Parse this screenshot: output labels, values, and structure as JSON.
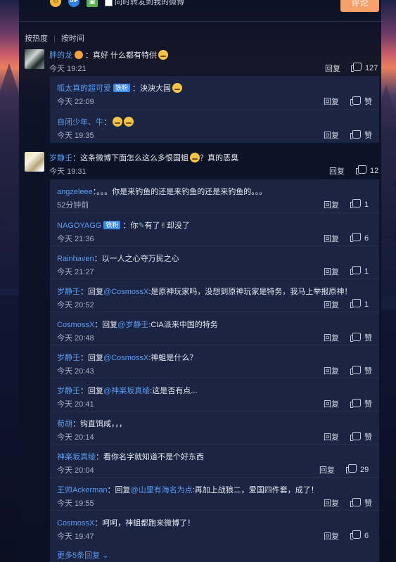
{
  "composer": {
    "forward_label": "同时转发到我的微博",
    "submit_label": "评论"
  },
  "sort": {
    "hot": "按热度",
    "time": "按时间"
  },
  "comments": [
    {
      "user": "胖的龙",
      "text": "：真好 什么都有特供",
      "time": "今天 19:21",
      "reply": "回复",
      "likes": "127",
      "replies": [
        {
          "user": "呱太真的超可爱",
          "tag": "铁粉",
          "text": "：泱泱大国",
          "time": "今天 22:09",
          "reply": "回复",
          "likes": "赞"
        },
        {
          "user": "自闭少年、牛",
          "text": "：",
          "time": "今天 19:35",
          "reply": "回复",
          "likes": "赞"
        }
      ]
    },
    {
      "user": "岁静壬",
      "text": "：这条微博下面怎么这么多恨国蛆",
      "text2": "？真的恶臭",
      "time": "今天 19:31",
      "reply": "回复",
      "likes": "12",
      "replies": [
        {
          "user": "angzeleee",
          "text": "：。。。你是来钓鱼的还是来钓鱼的还是来钓鱼的。。。",
          "time": "52分钟前",
          "reply": "回复",
          "likes": "1"
        },
        {
          "user": "NAGOYAGG",
          "tag": "铁粉",
          "text": "：你",
          "text2": "有了",
          "text3": "却没了",
          "time": "今天 21:36",
          "reply": "回复",
          "likes": "6"
        },
        {
          "user": "Rainhaven",
          "text": "：以一人之心夺万民之心",
          "time": "今天 21:27",
          "reply": "回复",
          "likes": "1"
        },
        {
          "user": "岁静壬",
          "pre": "：回复",
          "mention": "@CosmossX",
          "text": ":是原神玩家吗，没想到原神玩家是特务，我马上举报原神！",
          "time": "今天 20:52",
          "reply": "回复",
          "likes": "1"
        },
        {
          "user": "CosmossX",
          "pre": "：回复",
          "mention": "@岁静壬",
          "text": ":CIA派来中国的特务",
          "time": "今天 20:48",
          "reply": "回复",
          "likes": "赞"
        },
        {
          "user": "岁静壬",
          "pre": "：回复",
          "mention": "@CosmossX",
          "text": ":神蛆是什么？",
          "time": "今天 20:43",
          "reply": "回复",
          "likes": "赞"
        },
        {
          "user": "岁静壬",
          "pre": "：回复",
          "mention": "@神楽坂真绫",
          "text": ":这是否有点...",
          "time": "今天 20:41",
          "reply": "回复",
          "likes": "赞"
        },
        {
          "user": "荀胡",
          "text": "：钩直饵咸，，，",
          "time": "今天 20:14",
          "reply": "回复",
          "likes": "赞"
        },
        {
          "user": "神楽坂真绫",
          "text": "：看你名字就知道不是个好东西",
          "time": "今天 20:04",
          "reply": "回复",
          "likes": "29"
        },
        {
          "user": "王帅Ackerman",
          "pre": "：回复",
          "mention": "@山里有海名为点",
          "text": ":再加上战狼二，爱国四件套，成了！",
          "time": "今天 19:55",
          "reply": "回复",
          "likes": "赞"
        },
        {
          "user": "CosmossX",
          "text": "：呵呵，神蛆都跑来微博了！",
          "time": "今天 19:47",
          "reply": "回复",
          "likes": "6"
        }
      ],
      "more": "更多5条回复"
    }
  ]
}
